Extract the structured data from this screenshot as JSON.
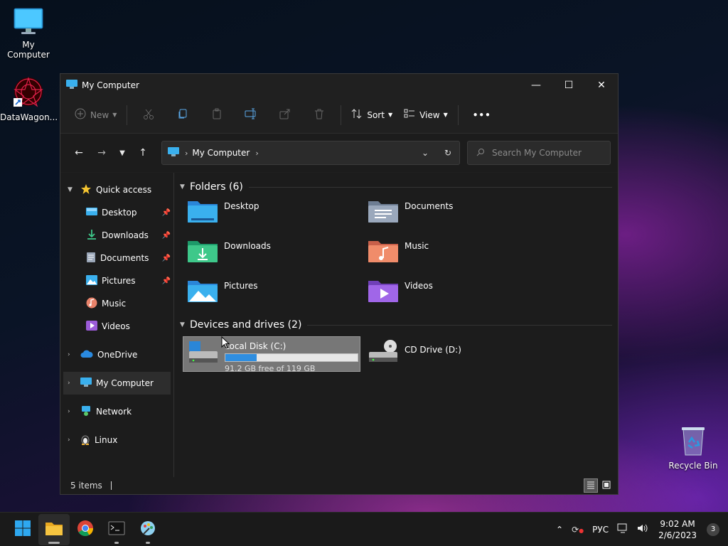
{
  "desktop": {
    "icons": [
      {
        "label": "My Computer"
      },
      {
        "label": "DataWagon..."
      },
      {
        "label": "Recycle Bin"
      }
    ]
  },
  "window": {
    "title": "My Computer",
    "controls": {
      "minimize": "—",
      "maximize": "☐",
      "close": "✕"
    }
  },
  "toolbar": {
    "new_label": "New",
    "sort_label": "Sort",
    "view_label": "View",
    "more_label": "•••"
  },
  "address": {
    "crumb": "My Computer",
    "search_placeholder": "Search My Computer"
  },
  "sidebar": {
    "quick_access": "Quick access",
    "pinned": [
      {
        "label": "Desktop"
      },
      {
        "label": "Downloads"
      },
      {
        "label": "Documents"
      },
      {
        "label": "Pictures"
      },
      {
        "label": "Music"
      },
      {
        "label": "Videos"
      }
    ],
    "onedrive": "OneDrive",
    "mycomputer": "My Computer",
    "network": "Network",
    "linux": "Linux"
  },
  "content": {
    "folders_header": "Folders (6)",
    "folders": [
      {
        "label": "Desktop"
      },
      {
        "label": "Documents"
      },
      {
        "label": "Downloads"
      },
      {
        "label": "Music"
      },
      {
        "label": "Pictures"
      },
      {
        "label": "Videos"
      }
    ],
    "drives_header": "Devices and drives (2)",
    "drives": [
      {
        "label": "Local Disk (C:)",
        "free": "91.2 GB free of 119 GB",
        "used_fraction": 0.234
      },
      {
        "label": "CD Drive (D:)"
      }
    ]
  },
  "status": {
    "items": "5 items"
  },
  "taskbar": {
    "tray": {
      "language": "РУС",
      "time": "9:02 AM",
      "date": "2/6/2023",
      "notifications": "3"
    }
  },
  "colors": {
    "accent": "#2f8ee0",
    "window_bg": "#1f1f1f",
    "folder_blue": "#3aa0e8"
  }
}
